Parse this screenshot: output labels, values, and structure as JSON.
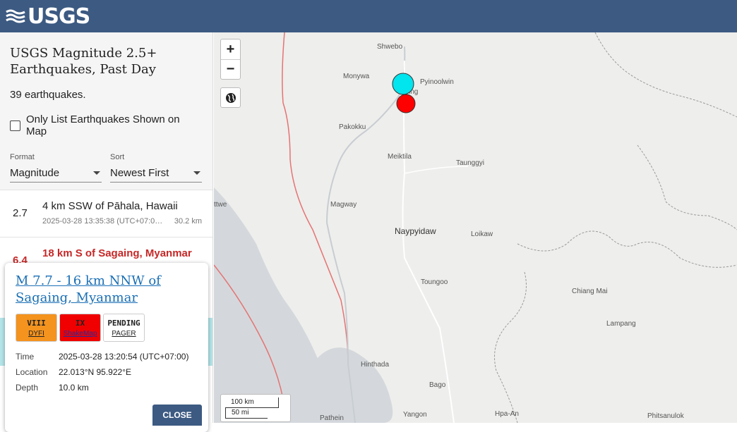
{
  "header": {
    "logo_text": "USGS"
  },
  "sidebar": {
    "title": "USGS Magnitude 2.5+ Earthquakes, Past Day",
    "count": "39 earthquakes.",
    "only_list_label": "Only List Earthquakes Shown on Map",
    "format": {
      "label": "Format",
      "value": "Magnitude"
    },
    "sort": {
      "label": "Sort",
      "value": "Newest First"
    },
    "events": [
      {
        "mag": "2.7",
        "place": "4 km SSW of Pāhala, Hawaii",
        "time": "2025-03-28 13:35:38 (UTC+07:0…",
        "depth": "30.2 km"
      },
      {
        "mag": "6.4",
        "place": "18 km S of Sagaing, Myanmar",
        "time": "",
        "depth": ""
      }
    ]
  },
  "popup": {
    "title": "M 7.7 - 16 km NNW of Sagaing, Myanmar",
    "badges": [
      {
        "top": "VIII",
        "bottom": "DYFI",
        "color": "#f4931e"
      },
      {
        "top": "IX",
        "bottom": "ShakeMap",
        "color": "#f00000"
      },
      {
        "top": "PENDING",
        "bottom": "PAGER",
        "color": "#ffffff"
      }
    ],
    "rows": [
      {
        "label": "Time",
        "value": "2025-03-28 13:20:54 (UTC+07:00)"
      },
      {
        "label": "Location",
        "value": "22.013°N 95.922°E"
      },
      {
        "label": "Depth",
        "value": "10.0 km"
      }
    ],
    "close_label": "CLOSE"
  },
  "map": {
    "zoom_in": "+",
    "zoom_out": "−",
    "scale_km": "100 km",
    "scale_mi": "50 mi",
    "cities": [
      "Shwebo",
      "Monywa",
      "Pyinoolwin",
      "ing",
      "Pakokku",
      "Meiktila",
      "Taunggyi",
      "Magway",
      "Naypyidaw",
      "Loikaw",
      "Toungoo",
      "Chiang Mai",
      "Lampang",
      "Hinthada",
      "Bago",
      "Yangon",
      "Hpa-An",
      "Phitsanulok",
      "Pathein",
      "ttwe"
    ],
    "markers": [
      {
        "name": "M 7.7 mainshock",
        "color": "#00e5ee"
      },
      {
        "name": "M 6.4 aftershock",
        "color": "#ff0000"
      }
    ]
  },
  "colors": {
    "header": "#3c5a82",
    "selected_row": "#b3e5e8",
    "link": "#1a6fb5",
    "alert_red": "#c62828"
  }
}
